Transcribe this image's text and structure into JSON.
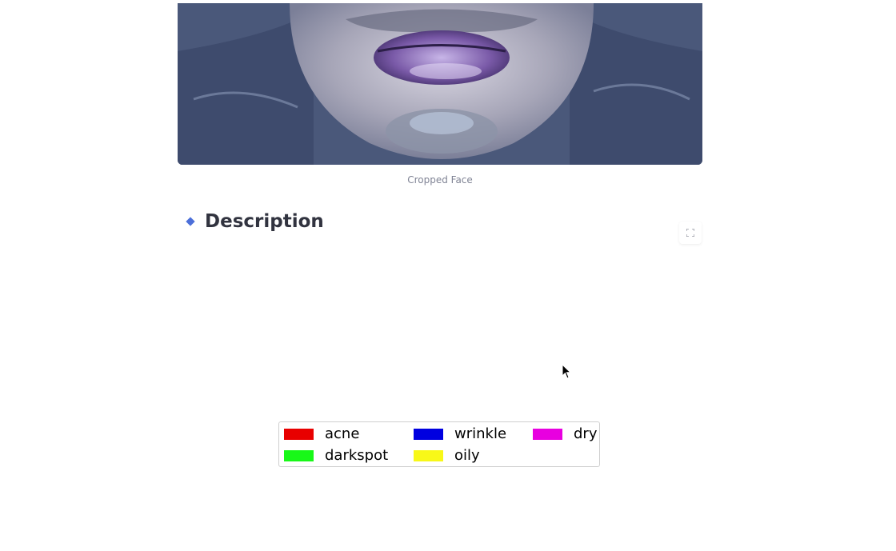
{
  "image": {
    "caption": "Cropped Face"
  },
  "section": {
    "title": "Description"
  },
  "legend": {
    "items": [
      {
        "label": "acne",
        "color": "#e80000"
      },
      {
        "label": "wrinkle",
        "color": "#0000e0"
      },
      {
        "label": "dry",
        "color": "#e800e0"
      },
      {
        "label": "darkspot",
        "color": "#18f818"
      },
      {
        "label": "oily",
        "color": "#f8f818"
      }
    ]
  },
  "icons": {
    "expand": "expand-icon",
    "heading_marker": "diamond-icon",
    "cursor": "pointer-cursor"
  }
}
